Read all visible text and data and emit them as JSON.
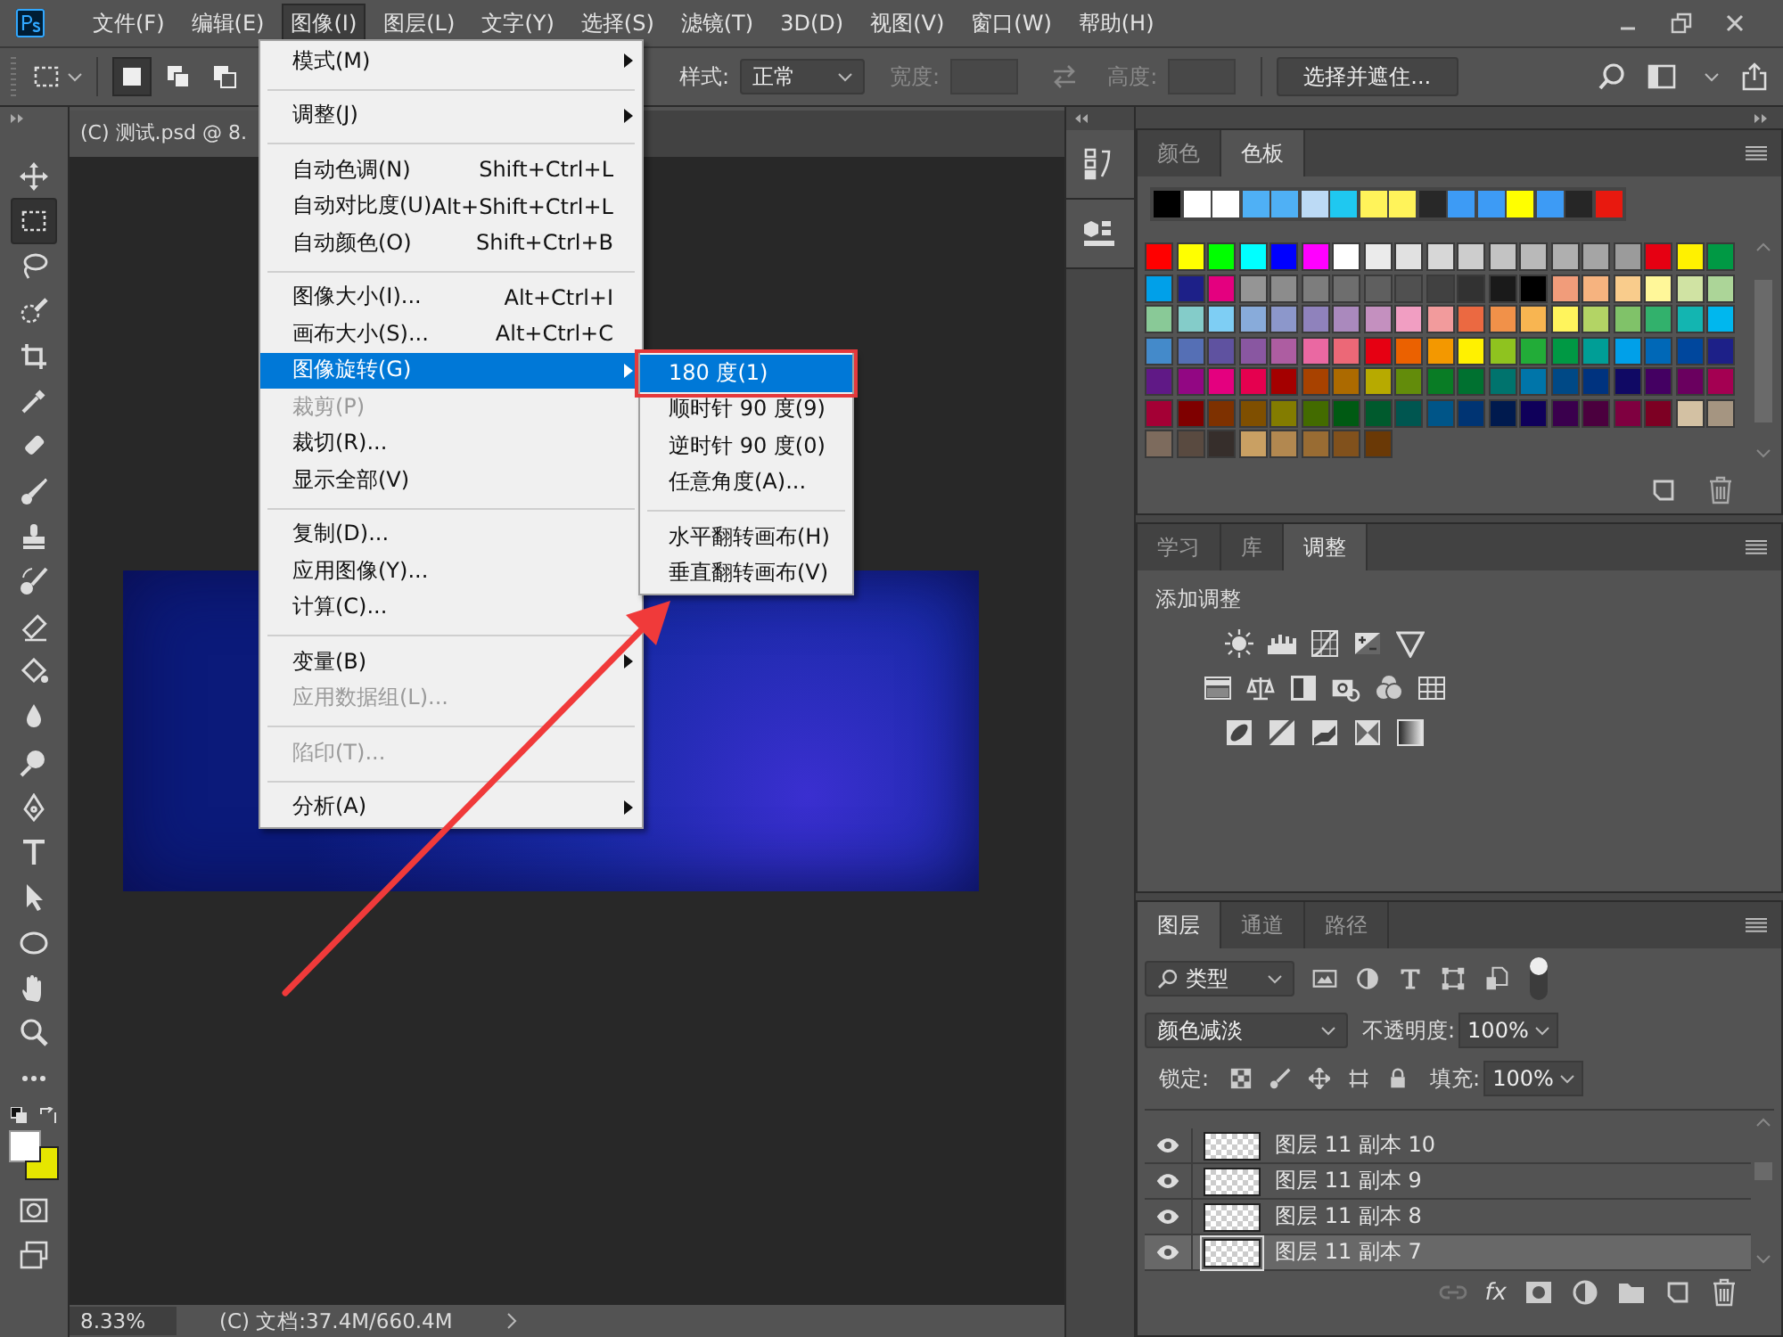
{
  "menubar": {
    "items": [
      {
        "label": "文件(F)",
        "selected": false
      },
      {
        "label": "编辑(E)",
        "selected": false
      },
      {
        "label": "图像(I)",
        "selected": true
      },
      {
        "label": "图层(L)",
        "selected": false
      },
      {
        "label": "文字(Y)",
        "selected": false
      },
      {
        "label": "选择(S)",
        "selected": false
      },
      {
        "label": "滤镜(T)",
        "selected": false
      },
      {
        "label": "3D(D)",
        "selected": false
      },
      {
        "label": "视图(V)",
        "selected": false
      },
      {
        "label": "窗口(W)",
        "selected": false
      },
      {
        "label": "帮助(H)",
        "selected": false
      }
    ]
  },
  "options_bar": {
    "selection_modes": [
      {
        "kind": "new",
        "selected": true
      },
      {
        "kind": "add",
        "selected": false
      },
      {
        "kind": "subtract",
        "selected": false
      }
    ],
    "style_label": "样式:",
    "style_value": "正常",
    "size_fields": [
      {
        "label": "宽度:",
        "disabled": true
      },
      {
        "label": "高度:",
        "disabled": true
      }
    ],
    "mask_button": "选择并遮住..."
  },
  "tools": [
    {
      "kind": "move",
      "selected": false
    },
    {
      "kind": "marquee",
      "selected": true
    },
    {
      "kind": "lasso",
      "selected": false
    },
    {
      "kind": "quick-select",
      "selected": false
    },
    {
      "kind": "crop",
      "selected": false
    },
    {
      "kind": "eyedropper",
      "selected": false
    },
    {
      "kind": "healing",
      "selected": false
    },
    {
      "kind": "brush",
      "selected": false
    },
    {
      "kind": "stamp",
      "selected": false
    },
    {
      "kind": "history-brush",
      "selected": false
    },
    {
      "kind": "eraser",
      "selected": false
    },
    {
      "kind": "bucket",
      "selected": false
    },
    {
      "kind": "blur",
      "selected": false
    },
    {
      "kind": "dodge",
      "selected": false
    },
    {
      "kind": "pen",
      "selected": false
    },
    {
      "kind": "type",
      "selected": false
    },
    {
      "kind": "path-select",
      "selected": false
    },
    {
      "kind": "ellipse",
      "selected": false
    },
    {
      "kind": "hand",
      "selected": false
    },
    {
      "kind": "zoom",
      "selected": false
    },
    {
      "kind": "more",
      "selected": false
    }
  ],
  "color_chips": [
    {
      "kind": "foreground",
      "color": "#ffffff"
    },
    {
      "kind": "background",
      "color": "#e6e600"
    }
  ],
  "document": {
    "tab": "(C) 测试.psd @ 8."
  },
  "image_menu": {
    "items": [
      {
        "kind": "item",
        "label": "模式(M)",
        "submenu": true,
        "disabled": false,
        "selected": false
      },
      {
        "kind": "separator"
      },
      {
        "kind": "item",
        "label": "调整(J)",
        "submenu": true,
        "disabled": false,
        "selected": false
      },
      {
        "kind": "separator"
      },
      {
        "kind": "item",
        "label": "自动色调(N)",
        "shortcut": "Shift+Ctrl+L",
        "submenu": false,
        "disabled": false,
        "selected": false
      },
      {
        "kind": "item",
        "label": "自动对比度(U)",
        "shortcut": "Alt+Shift+Ctrl+L",
        "submenu": false,
        "disabled": false,
        "selected": false
      },
      {
        "kind": "item",
        "label": "自动颜色(O)",
        "shortcut": "Shift+Ctrl+B",
        "submenu": false,
        "disabled": false,
        "selected": false
      },
      {
        "kind": "separator"
      },
      {
        "kind": "item",
        "label": "图像大小(I)...",
        "shortcut": "Alt+Ctrl+I",
        "submenu": false,
        "disabled": false,
        "selected": false
      },
      {
        "kind": "item",
        "label": "画布大小(S)...",
        "shortcut": "Alt+Ctrl+C",
        "submenu": false,
        "disabled": false,
        "selected": false
      },
      {
        "kind": "item",
        "label": "图像旋转(G)",
        "submenu": true,
        "disabled": false,
        "selected": true
      },
      {
        "kind": "item",
        "label": "裁剪(P)",
        "submenu": false,
        "disabled": true,
        "selected": false
      },
      {
        "kind": "item",
        "label": "裁切(R)...",
        "submenu": false,
        "disabled": false,
        "selected": false
      },
      {
        "kind": "item",
        "label": "显示全部(V)",
        "submenu": false,
        "disabled": false,
        "selected": false
      },
      {
        "kind": "separator"
      },
      {
        "kind": "item",
        "label": "复制(D)...",
        "submenu": false,
        "disabled": false,
        "selected": false
      },
      {
        "kind": "item",
        "label": "应用图像(Y)...",
        "submenu": false,
        "disabled": false,
        "selected": false
      },
      {
        "kind": "item",
        "label": "计算(C)...",
        "submenu": false,
        "disabled": false,
        "selected": false
      },
      {
        "kind": "separator"
      },
      {
        "kind": "item",
        "label": "变量(B)",
        "submenu": true,
        "disabled": false,
        "selected": false
      },
      {
        "kind": "item",
        "label": "应用数据组(L)...",
        "submenu": false,
        "disabled": true,
        "selected": false
      },
      {
        "kind": "separator"
      },
      {
        "kind": "item",
        "label": "陷印(T)...",
        "submenu": false,
        "disabled": true,
        "selected": false
      },
      {
        "kind": "separator"
      },
      {
        "kind": "item",
        "label": "分析(A)",
        "submenu": true,
        "disabled": false,
        "selected": false
      }
    ]
  },
  "rotate_submenu": {
    "items": [
      {
        "kind": "item",
        "label": "180 度(1)",
        "selected": true,
        "annotated": true
      },
      {
        "kind": "item",
        "label": "顺时针 90 度(9)",
        "selected": false,
        "annotated": false
      },
      {
        "kind": "item",
        "label": "逆时针 90 度(0)",
        "selected": false,
        "annotated": false
      },
      {
        "kind": "item",
        "label": "任意角度(A)...",
        "selected": false,
        "annotated": false
      },
      {
        "kind": "separator"
      },
      {
        "kind": "item",
        "label": "水平翻转画布(H)",
        "selected": false,
        "annotated": false
      },
      {
        "kind": "item",
        "label": "垂直翻转画布(V)",
        "selected": false,
        "annotated": false
      }
    ]
  },
  "status_bar": {
    "zoom": "8.33%",
    "doc_info": "(C) 文档:37.4M/660.4M"
  },
  "swatch_panel": {
    "tabs": [
      {
        "label": "颜色",
        "selected": false
      },
      {
        "label": "色板",
        "selected": true
      }
    ],
    "recent": [
      {
        "color": "#000000"
      },
      {
        "color": "#ffffff"
      },
      {
        "color": "#ffffff"
      },
      {
        "color": "#4fb0f5"
      },
      {
        "color": "#4fb0f5"
      },
      {
        "color": "#bcdaf5"
      },
      {
        "color": "#1fc8f0"
      },
      {
        "color": "#fff35a"
      },
      {
        "color": "#fff35a"
      },
      {
        "color": "#282828"
      },
      {
        "color": "#3d9bf5"
      },
      {
        "color": "#3d9bf5"
      },
      {
        "color": "#ffff00"
      },
      {
        "color": "#3d9bf5"
      },
      {
        "color": "#262626"
      },
      {
        "color": "#e8190f"
      }
    ],
    "swatches": [
      {
        "color": "#ff0000"
      },
      {
        "color": "#ffff00"
      },
      {
        "color": "#00ff00"
      },
      {
        "color": "#00ffff"
      },
      {
        "color": "#0000ff"
      },
      {
        "color": "#ff00ff"
      },
      {
        "color": "#ffffff"
      },
      {
        "color": "#ebebeb"
      },
      {
        "color": "#e1e1e1"
      },
      {
        "color": "#d7d7d7"
      },
      {
        "color": "#cdcdcd"
      },
      {
        "color": "#c3c3c3"
      },
      {
        "color": "#b9b9b9"
      },
      {
        "color": "#afafaf"
      },
      {
        "color": "#a5a5a5"
      },
      {
        "color": "#9b9b9b"
      },
      {
        "color": "#e60012"
      },
      {
        "color": "#fff100"
      },
      {
        "color": "#009944"
      },
      {
        "color": "#00a0e9"
      },
      {
        "color": "#1d2088"
      },
      {
        "color": "#e4007f"
      },
      {
        "color": "#959595"
      },
      {
        "color": "#8c8c8c"
      },
      {
        "color": "#7d7d7d"
      },
      {
        "color": "#6e6e6e"
      },
      {
        "color": "#5f5f5f"
      },
      {
        "color": "#505050"
      },
      {
        "color": "#414141"
      },
      {
        "color": "#323232"
      },
      {
        "color": "#1a1a1a"
      },
      {
        "color": "#000000"
      },
      {
        "color": "#f19c7a"
      },
      {
        "color": "#f6b37f"
      },
      {
        "color": "#f9cc8c"
      },
      {
        "color": "#fff799"
      },
      {
        "color": "#d0e3a3"
      },
      {
        "color": "#acd598"
      },
      {
        "color": "#89c997"
      },
      {
        "color": "#84ccc9"
      },
      {
        "color": "#7ecef4"
      },
      {
        "color": "#88abda"
      },
      {
        "color": "#8c97cb"
      },
      {
        "color": "#8f82bc"
      },
      {
        "color": "#aa89bd"
      },
      {
        "color": "#c490bf"
      },
      {
        "color": "#f19ec2"
      },
      {
        "color": "#f29b9c"
      },
      {
        "color": "#eb6941"
      },
      {
        "color": "#f19149"
      },
      {
        "color": "#f8b551"
      },
      {
        "color": "#fff45c"
      },
      {
        "color": "#b3d465"
      },
      {
        "color": "#80c269"
      },
      {
        "color": "#32b16c"
      },
      {
        "color": "#13b5b1"
      },
      {
        "color": "#00b7ee"
      },
      {
        "color": "#448aca"
      },
      {
        "color": "#556fb5"
      },
      {
        "color": "#5f52a0"
      },
      {
        "color": "#8957a1"
      },
      {
        "color": "#ad5da1"
      },
      {
        "color": "#ea68a2"
      },
      {
        "color": "#ec6877"
      },
      {
        "color": "#e60012"
      },
      {
        "color": "#eb6100"
      },
      {
        "color": "#f39800"
      },
      {
        "color": "#fff100"
      },
      {
        "color": "#8fc31f"
      },
      {
        "color": "#22ac38"
      },
      {
        "color": "#009944"
      },
      {
        "color": "#009e96"
      },
      {
        "color": "#00a0e9"
      },
      {
        "color": "#0068b7"
      },
      {
        "color": "#00479d"
      },
      {
        "color": "#1d2088"
      },
      {
        "color": "#601986"
      },
      {
        "color": "#920783"
      },
      {
        "color": "#e4007f"
      },
      {
        "color": "#e5004f"
      },
      {
        "color": "#a40000"
      },
      {
        "color": "#a84200"
      },
      {
        "color": "#ac6a00"
      },
      {
        "color": "#b7aa00"
      },
      {
        "color": "#638c0b"
      },
      {
        "color": "#097c25"
      },
      {
        "color": "#007130"
      },
      {
        "color": "#00736d"
      },
      {
        "color": "#0075a9"
      },
      {
        "color": "#004986"
      },
      {
        "color": "#00337f"
      },
      {
        "color": "#100964"
      },
      {
        "color": "#440062"
      },
      {
        "color": "#6a005f"
      },
      {
        "color": "#a40052"
      },
      {
        "color": "#a40035"
      },
      {
        "color": "#7f0000"
      },
      {
        "color": "#7e3100"
      },
      {
        "color": "#7f4f00"
      },
      {
        "color": "#837c00"
      },
      {
        "color": "#436b00"
      },
      {
        "color": "#005a13"
      },
      {
        "color": "#005a2d"
      },
      {
        "color": "#005650"
      },
      {
        "color": "#005588"
      },
      {
        "color": "#003473"
      },
      {
        "color": "#001a4e"
      },
      {
        "color": "#0f005a"
      },
      {
        "color": "#3a004d"
      },
      {
        "color": "#4b003e"
      },
      {
        "color": "#7f0040"
      },
      {
        "color": "#7d0023"
      },
      {
        "color": "#d3c1a3"
      },
      {
        "color": "#a59581"
      },
      {
        "color": "#7d6b5d"
      },
      {
        "color": "#594a40"
      },
      {
        "color": "#362e2b"
      },
      {
        "color": "#c9a063"
      },
      {
        "color": "#b28850"
      },
      {
        "color": "#996c33"
      },
      {
        "color": "#81511c"
      },
      {
        "color": "#6a3906"
      }
    ]
  },
  "adjust_panel": {
    "tabs": [
      {
        "label": "学习",
        "selected": false
      },
      {
        "label": "库",
        "selected": false
      },
      {
        "label": "调整",
        "selected": true
      }
    ],
    "heading": "添加调整"
  },
  "layers_panel": {
    "tabs": [
      {
        "label": "图层",
        "selected": true
      },
      {
        "label": "通道",
        "selected": false
      },
      {
        "label": "路径",
        "selected": false
      }
    ],
    "filter": "类型",
    "blend_mode": "颜色减淡",
    "opacity_label": "不透明度:",
    "opacity": "100%",
    "lock_label": "锁定:",
    "fill_label": "填充:",
    "fill": "100%",
    "layers": [
      {
        "name": "图层 11 副本 10",
        "visible": true,
        "selected": false
      },
      {
        "name": "图层 11 副本 9",
        "visible": true,
        "selected": false
      },
      {
        "name": "图层 11 副本 8",
        "visible": true,
        "selected": false
      },
      {
        "name": "图层 11 副本 7",
        "visible": true,
        "selected": true
      }
    ],
    "fx_label": "fx"
  }
}
